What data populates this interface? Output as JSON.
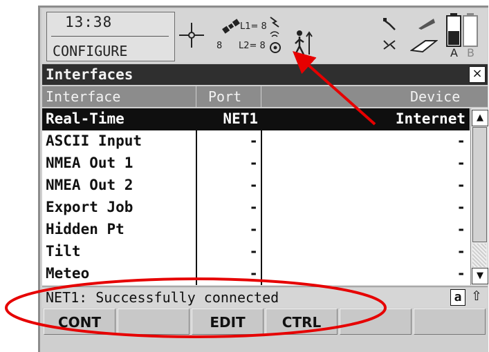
{
  "status": {
    "time": "13:38",
    "mode": "CONFIGURE",
    "sat_l1": "L1= 8",
    "sat_l2": "L2= 8",
    "sat_count": "8",
    "batt_a": "A",
    "batt_b": "B"
  },
  "window": {
    "title": "Interfaces",
    "close_glyph": "×"
  },
  "columns": {
    "interface": "Interface",
    "port": "Port",
    "device": "Device"
  },
  "rows": [
    {
      "interface": "Real-Time",
      "port": "NET1",
      "device": "Internet",
      "selected": true
    },
    {
      "interface": "ASCII Input",
      "port": "-",
      "device": "-"
    },
    {
      "interface": "NMEA Out 1",
      "port": "-",
      "device": "-"
    },
    {
      "interface": "NMEA Out 2",
      "port": "-",
      "device": "-"
    },
    {
      "interface": "Export Job",
      "port": "-",
      "device": "-"
    },
    {
      "interface": "Hidden Pt",
      "port": "-",
      "device": "-"
    },
    {
      "interface": "Tilt",
      "port": "-",
      "device": "-"
    },
    {
      "interface": "Meteo",
      "port": "-",
      "device": "-"
    }
  ],
  "scroll": {
    "up": "▲",
    "down": "▼"
  },
  "message": {
    "text": "NET1: Successfully connected",
    "input_mode": "a",
    "shift": "⇧"
  },
  "fkeys": [
    "CONT",
    "",
    "EDIT",
    "CTRL",
    "",
    ""
  ],
  "annotation_color": "#e60000"
}
